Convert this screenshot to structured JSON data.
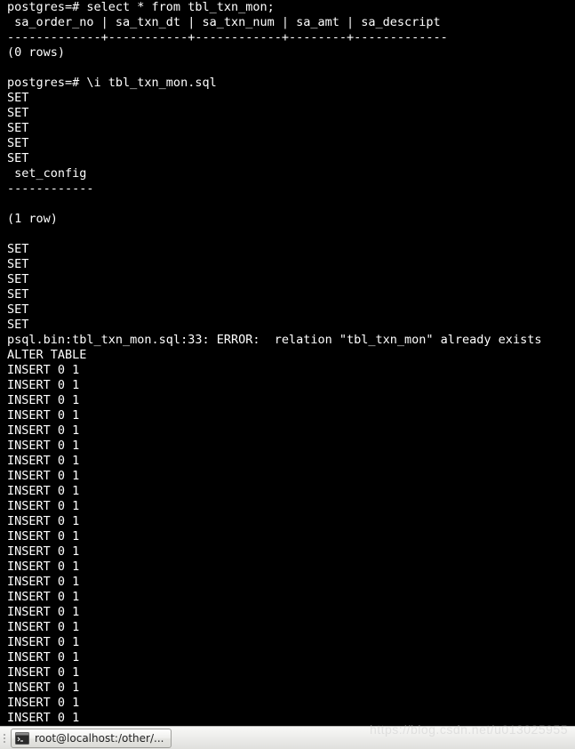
{
  "terminal": {
    "lines": [
      "postgres=# select * from tbl_txn_mon;",
      " sa_order_no | sa_txn_dt | sa_txn_num | sa_amt | sa_descript",
      "-------------+-----------+------------+--------+-------------",
      "(0 rows)",
      "",
      "postgres=# \\i tbl_txn_mon.sql",
      "SET",
      "SET",
      "SET",
      "SET",
      "SET",
      " set_config",
      "------------",
      "",
      "(1 row)",
      "",
      "SET",
      "SET",
      "SET",
      "SET",
      "SET",
      "SET",
      "psql.bin:tbl_txn_mon.sql:33: ERROR:  relation \"tbl_txn_mon\" already exists",
      "ALTER TABLE",
      "INSERT 0 1",
      "INSERT 0 1",
      "INSERT 0 1",
      "INSERT 0 1",
      "INSERT 0 1",
      "INSERT 0 1",
      "INSERT 0 1",
      "INSERT 0 1",
      "INSERT 0 1",
      "INSERT 0 1",
      "INSERT 0 1",
      "INSERT 0 1",
      "INSERT 0 1",
      "INSERT 0 1",
      "INSERT 0 1",
      "INSERT 0 1",
      "INSERT 0 1",
      "INSERT 0 1",
      "INSERT 0 1",
      "INSERT 0 1",
      "INSERT 0 1",
      "INSERT 0 1",
      "INSERT 0 1",
      "INSERT 0 1"
    ]
  },
  "taskbar": {
    "button_label": "root@localhost:/other/..."
  },
  "watermark": "https://blog.csdn.net/u013025955"
}
